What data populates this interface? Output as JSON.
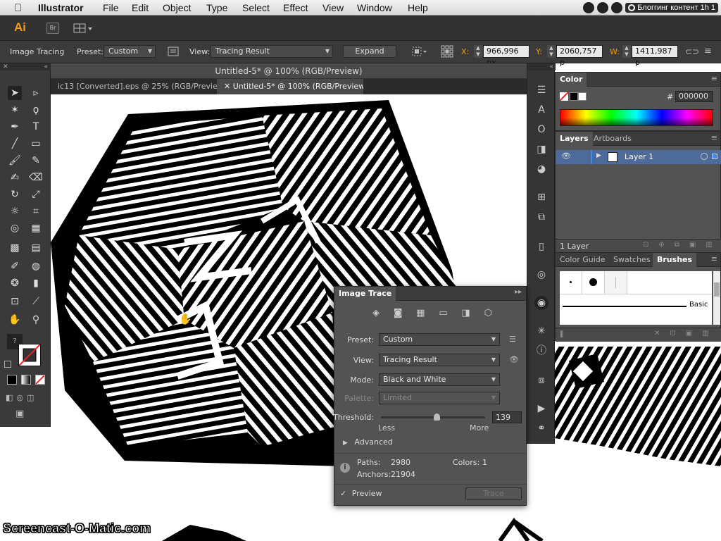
{
  "menubar": {
    "app_name": "Illustrator",
    "items": [
      "File",
      "Edit",
      "Object",
      "Type",
      "Select",
      "Effect",
      "View",
      "Window",
      "Help"
    ],
    "status_text": "Блоггинг контент  1h 1"
  },
  "appbar": {
    "logo": "Ai",
    "bridge": "Br"
  },
  "control": {
    "context_label": "Image Tracing",
    "preset_label": "Preset:",
    "preset_value": "Custom",
    "view_label": "View:",
    "view_value": "Tracing Result",
    "expand_label": "Expand",
    "x_label": "X:",
    "x_value": "966,996 px",
    "y_label": "Y:",
    "y_value": "2060,757 p",
    "w_label": "W:",
    "w_value": "1411,987 p"
  },
  "document": {
    "title": "Untitled-5* @ 100% (RGB/Preview)",
    "tabs": [
      {
        "label": "ic13 [Converted].eps @ 25% (RGB/Preview)"
      },
      {
        "label": "✕  Untitled-5* @ 100% (RGB/Preview)"
      }
    ]
  },
  "color_panel": {
    "title": "Color",
    "hash": "#",
    "hex_value": "000000"
  },
  "layers_panel": {
    "tabs": [
      "Layers",
      "Artboards"
    ],
    "layer_name": "Layer 1",
    "footer": "1 Layer"
  },
  "brushes_panel": {
    "tabs": [
      "Color Guide",
      "Swatches",
      "Brushes"
    ],
    "basic_label": "Basic"
  },
  "image_trace": {
    "title": "Image Trace",
    "preset_label": "Preset:",
    "preset_value": "Custom",
    "view_label": "View:",
    "view_value": "Tracing Result",
    "mode_label": "Mode:",
    "mode_value": "Black and White",
    "palette_label": "Palette:",
    "palette_value": "Limited",
    "threshold_label": "Threshold:",
    "threshold_value": "139",
    "threshold_fraction": 0.54,
    "less_label": "Less",
    "more_label": "More",
    "advanced_label": "Advanced",
    "paths_label": "Paths:",
    "paths_value": "2980",
    "colors_label": "Colors:",
    "colors_value": "1",
    "anchors_label": "Anchors:",
    "anchors_value": "21904",
    "preview_label": "Preview",
    "trace_label": "Trace"
  },
  "watermark": "Screencast-O-Matic.com",
  "colors": {
    "accent_orange": "#f39c12",
    "panel_dark": "#3a3a3a",
    "selection_blue": "#4d6a9a"
  }
}
